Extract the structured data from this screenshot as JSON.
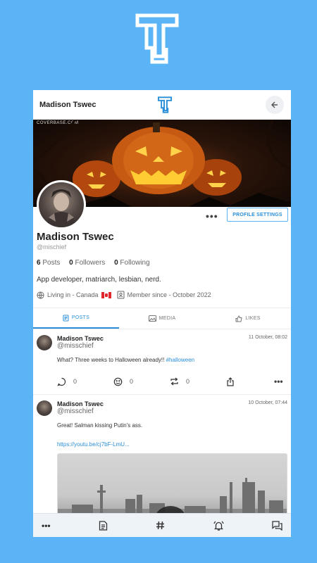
{
  "brand": {
    "logo_icon": "tswec-logo-icon"
  },
  "header": {
    "name": "Madison Tswec",
    "back_icon": "arrow-left-icon"
  },
  "cover": {
    "watermark": "COVERBASE.COM"
  },
  "profile": {
    "name": "Madison Tswec",
    "handle": "@mischief",
    "settings_label": "PROFILE SETTINGS",
    "more_label": "•••",
    "stats": {
      "posts_count": "6",
      "posts_label": "Posts",
      "followers_count": "0",
      "followers_label": "Followers",
      "following_count": "0",
      "following_label": "Following"
    },
    "bio": "App developer, matriarch, lesbian, nerd.",
    "location": "Living in - Canada",
    "member_since": "Member since - October 2022"
  },
  "tabs": [
    {
      "label": "POSTS",
      "icon": "document-icon",
      "active": true
    },
    {
      "label": "MEDIA",
      "icon": "image-icon",
      "active": false
    },
    {
      "label": "LIKES",
      "icon": "thumbs-up-icon",
      "active": false
    }
  ],
  "posts": [
    {
      "author": "Madison Tswec",
      "handle": "@misschief",
      "date": "11 October, 08:02",
      "text": "What? Three weeks to Halloween already!! ",
      "hashtag": "#halloween",
      "comments": "0",
      "reactions": "0",
      "reposts": "0"
    },
    {
      "author": "Madison Tswec",
      "handle": "@misschief",
      "date": "10 October, 07:44",
      "text": "Great! Salman kissing Putin's ass.",
      "link": "https://youtu.be/cj7bF-LmU..."
    }
  ],
  "bottom_nav": [
    "more-icon",
    "feed-icon",
    "hashtag-icon",
    "notifications-icon",
    "messages-icon"
  ],
  "colors": {
    "background": "#5ab4f5",
    "accent": "#2a8fd8"
  }
}
